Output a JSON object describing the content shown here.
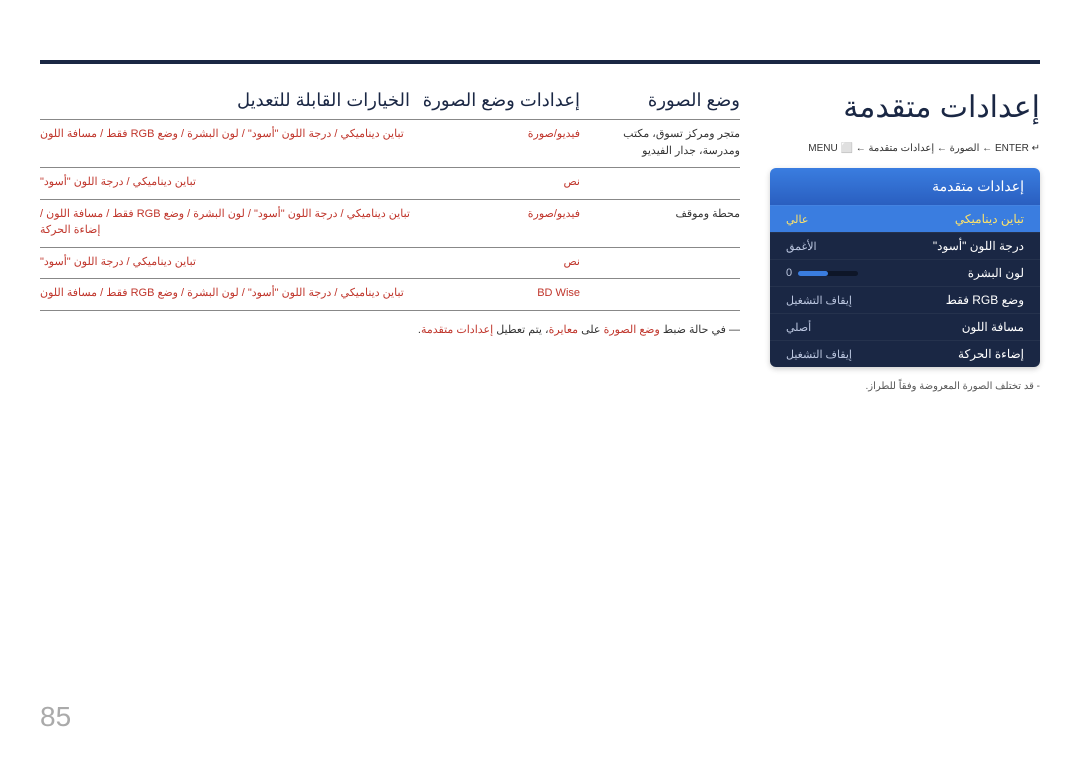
{
  "page_number": "85",
  "side": {
    "title": "إعدادات متقدمة",
    "breadcrumb": "MENU ⬜ ← الصورة ← إعدادات متقدمة ← ENTER ↵",
    "menu_title": "إعدادات متقدمة",
    "rows": [
      {
        "label": "تباين ديناميكي",
        "value": "عالي",
        "selected": true
      },
      {
        "label": "درجة اللون \"أسود\"",
        "value": "الأغمق"
      },
      {
        "label": "لون البشرة",
        "value": "0",
        "slider": true
      },
      {
        "label": "وضع RGB فقط",
        "value": "إيقاف التشغيل"
      },
      {
        "label": "مسافة اللون",
        "value": "أصلي"
      },
      {
        "label": "إضاءة الحركة",
        "value": "إيقاف التشغيل"
      }
    ],
    "note": "- قد تختلف الصورة المعروضة وفقاً للطراز."
  },
  "main": {
    "headers": {
      "mode": "وضع الصورة",
      "settings": "إعدادات وضع الصورة",
      "options": "الخيارات القابلة للتعديل"
    },
    "rows": [
      {
        "mode": "متجر ومركز تسوق، مكتب ومدرسة، جدار الفيديو",
        "setting": "فيديو/صورة",
        "options": "تباين ديناميكي / درجة اللون \"أسود\" / لون البشرة / وضع RGB فقط / مسافة اللون"
      },
      {
        "mode": "",
        "setting": "نص",
        "options": "تباين ديناميكي / درجة اللون \"أسود\""
      },
      {
        "mode": "محطة وموقف",
        "setting": "فيديو/صورة",
        "options": "تباين ديناميكي / درجة اللون \"أسود\" / لون البشرة / وضع RGB فقط / مسافة اللون / إضاءة الحركة"
      },
      {
        "mode": "",
        "setting": "نص",
        "options": "تباين ديناميكي / درجة اللون \"أسود\""
      },
      {
        "mode": "",
        "setting": "BD Wise",
        "options": "تباين ديناميكي / درجة اللون \"أسود\" / لون البشرة / وضع RGB فقط / مسافة اللون"
      }
    ],
    "footnote_pre": "― في حالة ضبط ",
    "footnote_r1": "وضع الصورة",
    "footnote_mid": " على ",
    "footnote_r2": "معايرة",
    "footnote_post": "، يتم تعطيل ",
    "footnote_r3": "إعدادات متقدمة",
    "footnote_end": "."
  }
}
